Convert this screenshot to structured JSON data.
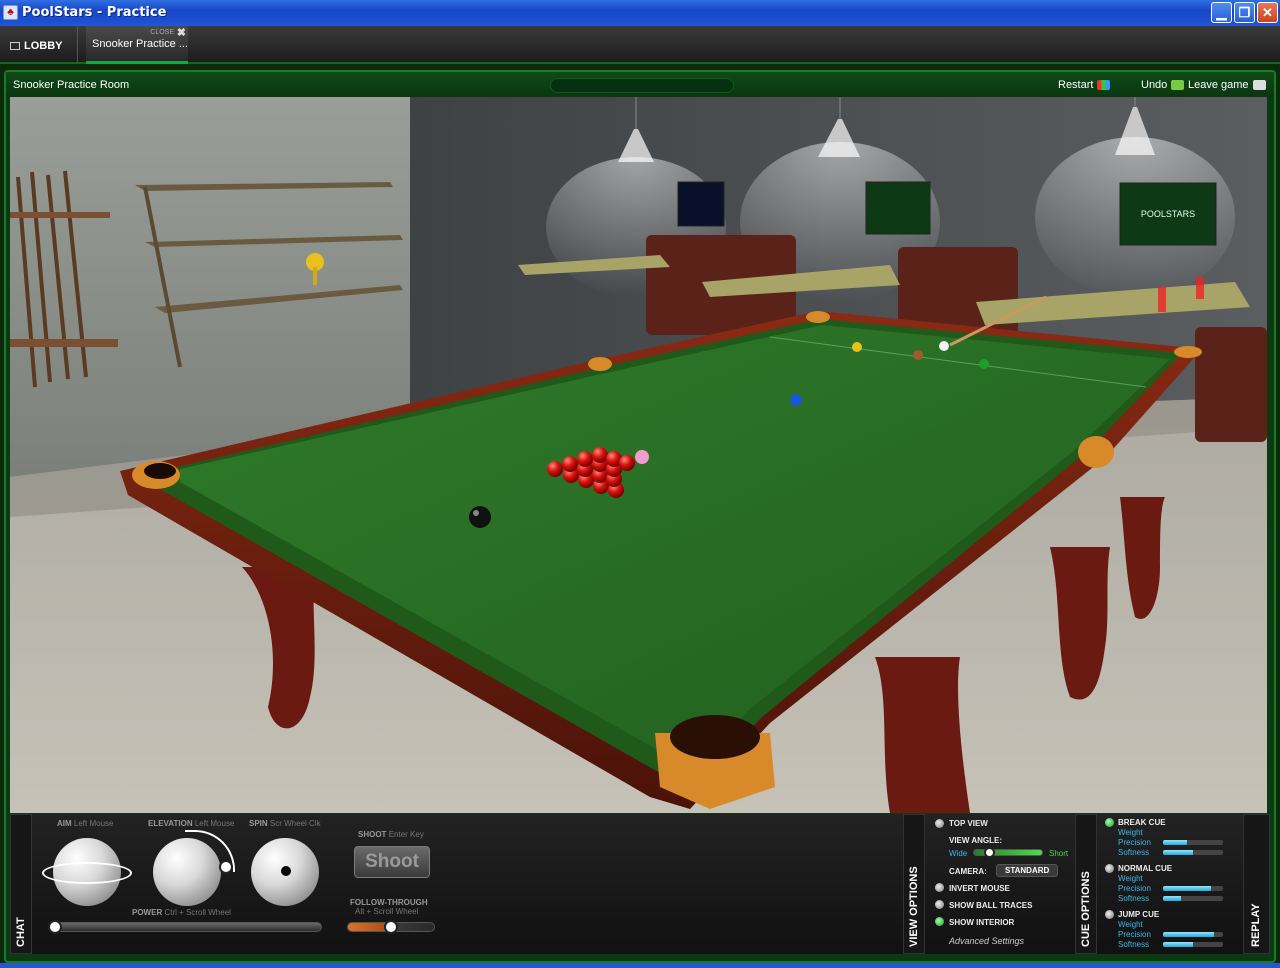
{
  "window": {
    "title": "PoolStars - Practice",
    "minimize_glyph": "▁",
    "maximize_glyph": "❐",
    "close_glyph": "✕"
  },
  "tabs": {
    "lobby_label": "LOBBY",
    "active_label": "Snooker Practice ...",
    "active_close_label": "CLOSE",
    "active_close_glyph": "✖"
  },
  "room": {
    "title": "Snooker Practice Room",
    "restart_label": "Restart",
    "undo_label": "Undo",
    "leave_label": "Leave game"
  },
  "scene": {
    "monitor_text": "POOLSTARS",
    "colors": {
      "cloth": "#2f7a2a",
      "rail": "#6b1a10",
      "pocket_brass": "#d88a2a"
    },
    "balls": {
      "reds": 15,
      "colours": [
        "black",
        "pink",
        "blue",
        "brown",
        "green",
        "yellow",
        "white"
      ]
    }
  },
  "controls": {
    "chat_label": "CHAT",
    "aim": {
      "label": "AIM",
      "hint": "Left Mouse"
    },
    "elevation": {
      "label": "ELEVATION",
      "hint": "Left Mouse"
    },
    "spin": {
      "label": "SPIN",
      "hint": "Scr Wheel Clk"
    },
    "shoot": {
      "label": "SHOOT",
      "hint": "Enter Key",
      "button": "Shoot"
    },
    "power": {
      "label": "POWER",
      "hint": "Ctrl + Scroll Wheel",
      "level": 0.0
    },
    "follow_through": {
      "label": "FOLLOW-THROUGH",
      "hint": "Alt + Scroll Wheel",
      "level": 0.5
    }
  },
  "view_options": {
    "label": "VIEW OPTIONS",
    "top_view": "TOP VIEW",
    "view_angle": "VIEW ANGLE:",
    "wide": "Wide",
    "short": "Short",
    "view_angle_level": 0.25,
    "camera_label": "CAMERA:",
    "camera_value": "STANDARD",
    "invert_mouse": "INVERT MOUSE",
    "show_ball_traces": "SHOW BALL TRACES",
    "show_interior": "SHOW INTERIOR",
    "advanced_settings": "Advanced Settings"
  },
  "cue_options": {
    "label": "CUE OPTIONS",
    "cues": [
      {
        "name": "BREAK CUE",
        "selected": true,
        "weight": "Weight",
        "precision": "Precision",
        "softness": "Softness",
        "precision_level": 0.4,
        "softness_level": 0.5
      },
      {
        "name": "NORMAL CUE",
        "selected": false,
        "weight": "Weight",
        "precision": "Precision",
        "softness": "Softness",
        "precision_level": 0.8,
        "softness_level": 0.3
      },
      {
        "name": "JUMP CUE",
        "selected": false,
        "weight": "Weight",
        "precision": "Precision",
        "softness": "Softness",
        "precision_level": 0.85,
        "softness_level": 0.5
      }
    ]
  },
  "replay_label": "REPLAY"
}
